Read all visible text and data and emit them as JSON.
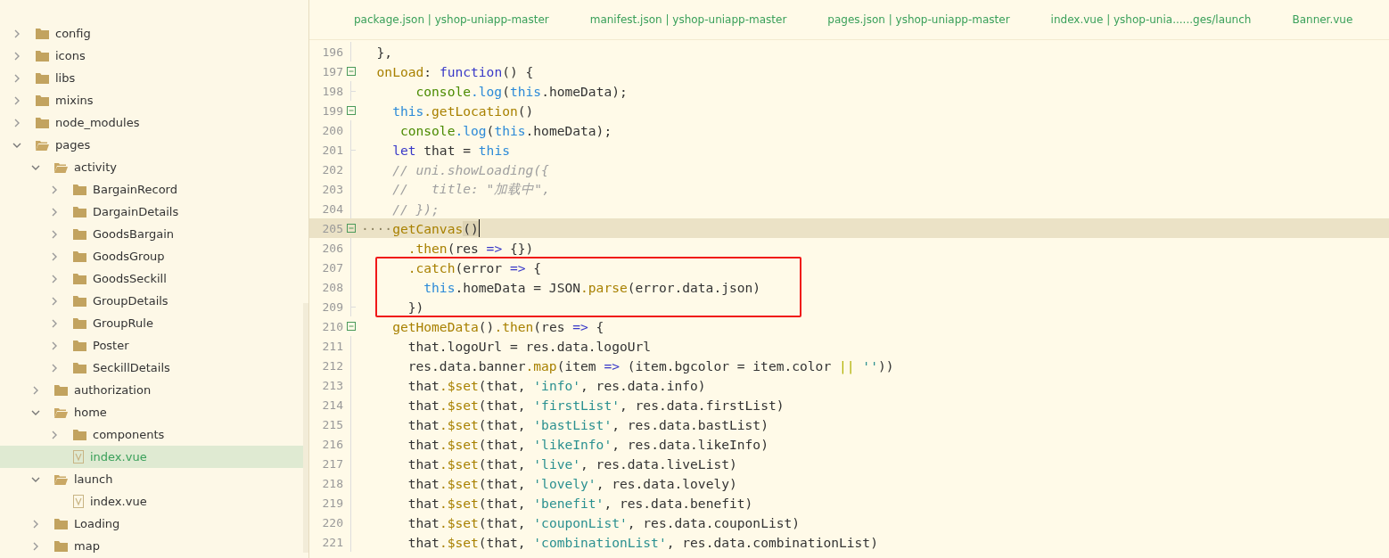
{
  "sidebar": {
    "items": [
      {
        "name": "config",
        "kind": "folder",
        "expanded": false,
        "selected": false
      },
      {
        "name": "icons",
        "kind": "folder",
        "expanded": false,
        "selected": false
      },
      {
        "name": "libs",
        "kind": "folder",
        "expanded": false,
        "selected": false
      },
      {
        "name": "mixins",
        "kind": "folder",
        "expanded": false,
        "selected": false
      },
      {
        "name": "node_modules",
        "kind": "folder",
        "expanded": false,
        "selected": false
      },
      {
        "name": "pages",
        "kind": "folder",
        "expanded": true,
        "selected": false,
        "children": [
          {
            "name": "activity",
            "kind": "folder",
            "expanded": true,
            "selected": false,
            "children": [
              {
                "name": "BargainRecord",
                "kind": "folder",
                "expanded": false,
                "selected": false
              },
              {
                "name": "DargainDetails",
                "kind": "folder",
                "expanded": false,
                "selected": false
              },
              {
                "name": "GoodsBargain",
                "kind": "folder",
                "expanded": false,
                "selected": false
              },
              {
                "name": "GoodsGroup",
                "kind": "folder",
                "expanded": false,
                "selected": false
              },
              {
                "name": "GoodsSeckill",
                "kind": "folder",
                "expanded": false,
                "selected": false
              },
              {
                "name": "GroupDetails",
                "kind": "folder",
                "expanded": false,
                "selected": false
              },
              {
                "name": "GroupRule",
                "kind": "folder",
                "expanded": false,
                "selected": false
              },
              {
                "name": "Poster",
                "kind": "folder",
                "expanded": false,
                "selected": false
              },
              {
                "name": "SeckillDetails",
                "kind": "folder",
                "expanded": false,
                "selected": false
              }
            ]
          },
          {
            "name": "authorization",
            "kind": "folder",
            "expanded": false,
            "selected": false
          },
          {
            "name": "home",
            "kind": "folder",
            "expanded": true,
            "selected": false,
            "children": [
              {
                "name": "components",
                "kind": "folder",
                "expanded": false,
                "selected": false
              },
              {
                "name": "index.vue",
                "kind": "file",
                "selected": true
              }
            ]
          },
          {
            "name": "launch",
            "kind": "folder",
            "expanded": true,
            "selected": false,
            "children": [
              {
                "name": "index.vue",
                "kind": "file",
                "selected": false
              }
            ]
          },
          {
            "name": "Loading",
            "kind": "folder",
            "expanded": false,
            "selected": false
          },
          {
            "name": "map",
            "kind": "folder",
            "expanded": false,
            "selected": false
          }
        ]
      }
    ]
  },
  "tabs": [
    {
      "label": "package.json | yshop-uniapp-master",
      "selected": false
    },
    {
      "label": "manifest.json | yshop-uniapp-master",
      "selected": false
    },
    {
      "label": "pages.json | yshop-uniapp-master",
      "selected": false
    },
    {
      "label": "index.vue | yshop-unia......ges/launch",
      "selected": false
    },
    {
      "label": "Banner.vue",
      "selected": false
    }
  ],
  "editor": {
    "lines": [
      {
        "number": "196",
        "foldable": false,
        "block_end": false,
        "current": false,
        "boxed": false,
        "tokens": [
          {
            "text": "  },",
            "kind": "plain"
          }
        ]
      },
      {
        "number": "197",
        "foldable": true,
        "block_end": false,
        "current": false,
        "boxed": false,
        "tokens": [
          {
            "text": "  onLoad",
            "kind": "prop"
          },
          {
            "text": ": ",
            "kind": "plain"
          },
          {
            "text": "function",
            "kind": "keyword"
          },
          {
            "text": "() {",
            "kind": "plain"
          }
        ]
      },
      {
        "number": "198",
        "foldable": false,
        "block_end": true,
        "current": false,
        "boxed": false,
        "tokens": [
          {
            "text": "       console",
            "kind": "global"
          },
          {
            "text": ".log",
            "kind": "this"
          },
          {
            "text": "(",
            "kind": "plain"
          },
          {
            "text": "this",
            "kind": "this"
          },
          {
            "text": ".homeData);",
            "kind": "plain"
          }
        ]
      },
      {
        "number": "199",
        "foldable": true,
        "block_end": false,
        "current": false,
        "boxed": false,
        "tokens": [
          {
            "text": "    this",
            "kind": "this"
          },
          {
            "text": ".getLocation",
            "kind": "prop"
          },
          {
            "text": "()",
            "kind": "plain"
          }
        ]
      },
      {
        "number": "200",
        "foldable": false,
        "block_end": false,
        "current": false,
        "boxed": false,
        "tokens": [
          {
            "text": "     console",
            "kind": "global"
          },
          {
            "text": ".log",
            "kind": "this"
          },
          {
            "text": "(",
            "kind": "plain"
          },
          {
            "text": "this",
            "kind": "this"
          },
          {
            "text": ".homeData);",
            "kind": "plain"
          }
        ]
      },
      {
        "number": "201",
        "foldable": false,
        "block_end": true,
        "current": false,
        "boxed": false,
        "tokens": [
          {
            "text": "    let",
            "kind": "keyword"
          },
          {
            "text": " that = ",
            "kind": "plain"
          },
          {
            "text": "this",
            "kind": "this"
          }
        ]
      },
      {
        "number": "202",
        "foldable": false,
        "block_end": false,
        "current": false,
        "boxed": false,
        "tokens": [
          {
            "text": "    // uni.showLoading({",
            "kind": "comment"
          }
        ]
      },
      {
        "number": "203",
        "foldable": false,
        "block_end": false,
        "current": false,
        "boxed": false,
        "tokens": [
          {
            "text": "    //   title: \"加载中\",",
            "kind": "comment"
          }
        ]
      },
      {
        "number": "204",
        "foldable": false,
        "block_end": false,
        "current": false,
        "boxed": false,
        "tokens": [
          {
            "text": "    // });",
            "kind": "comment"
          }
        ]
      },
      {
        "number": "205",
        "foldable": true,
        "block_end": false,
        "current": true,
        "boxed": false,
        "tokens": [
          {
            "text": "····",
            "kind": "whitespace"
          },
          {
            "text": "getCanvas",
            "kind": "prop"
          },
          {
            "text": "()",
            "kind": "bracket"
          }
        ]
      },
      {
        "number": "206",
        "foldable": false,
        "block_end": false,
        "current": false,
        "boxed": false,
        "tokens": [
          {
            "text": "      .then",
            "kind": "prop"
          },
          {
            "text": "(res ",
            "kind": "plain"
          },
          {
            "text": "=>",
            "kind": "keyword"
          },
          {
            "text": " {})",
            "kind": "plain"
          }
        ]
      },
      {
        "number": "207",
        "foldable": false,
        "block_end": false,
        "current": false,
        "boxed": true,
        "tokens": [
          {
            "text": "      .catch",
            "kind": "prop"
          },
          {
            "text": "(error ",
            "kind": "plain"
          },
          {
            "text": "=>",
            "kind": "keyword"
          },
          {
            "text": " {",
            "kind": "plain"
          }
        ]
      },
      {
        "number": "208",
        "foldable": false,
        "block_end": false,
        "current": false,
        "boxed": true,
        "tokens": [
          {
            "text": "        this",
            "kind": "this"
          },
          {
            "text": ".homeData = JSON",
            "kind": "plain"
          },
          {
            "text": ".parse",
            "kind": "prop"
          },
          {
            "text": "(error.data.json)",
            "kind": "plain"
          }
        ]
      },
      {
        "number": "209",
        "foldable": false,
        "block_end": true,
        "current": false,
        "boxed": true,
        "tokens": [
          {
            "text": "      })",
            "kind": "plain"
          }
        ]
      },
      {
        "number": "210",
        "foldable": true,
        "block_end": false,
        "current": false,
        "boxed": false,
        "tokens": [
          {
            "text": "    getHomeData",
            "kind": "prop"
          },
          {
            "text": "()",
            "kind": "plain"
          },
          {
            "text": ".then",
            "kind": "prop"
          },
          {
            "text": "(res ",
            "kind": "plain"
          },
          {
            "text": "=>",
            "kind": "keyword"
          },
          {
            "text": " {",
            "kind": "plain"
          }
        ]
      },
      {
        "number": "211",
        "foldable": false,
        "block_end": false,
        "current": false,
        "boxed": false,
        "tokens": [
          {
            "text": "      that.logoUrl = res.data.logoUrl",
            "kind": "plain"
          }
        ]
      },
      {
        "number": "212",
        "foldable": false,
        "block_end": false,
        "current": false,
        "boxed": false,
        "tokens": [
          {
            "text": "      res.data.banner",
            "kind": "plain"
          },
          {
            "text": ".map",
            "kind": "prop"
          },
          {
            "text": "(item ",
            "kind": "plain"
          },
          {
            "text": "=>",
            "kind": "keyword"
          },
          {
            "text": " (item.bgcolor = item.color ",
            "kind": "plain"
          },
          {
            "text": "||",
            "kind": "operator"
          },
          {
            "text": " ''",
            "kind": "string"
          },
          {
            "text": "))",
            "kind": "plain"
          }
        ]
      },
      {
        "number": "213",
        "foldable": false,
        "block_end": false,
        "current": false,
        "boxed": false,
        "tokens": [
          {
            "text": "      that",
            "kind": "plain"
          },
          {
            "text": ".$set",
            "kind": "prop"
          },
          {
            "text": "(that, ",
            "kind": "plain"
          },
          {
            "text": "'info'",
            "kind": "string"
          },
          {
            "text": ", res.data.info)",
            "kind": "plain"
          }
        ]
      },
      {
        "number": "214",
        "foldable": false,
        "block_end": false,
        "current": false,
        "boxed": false,
        "tokens": [
          {
            "text": "      that",
            "kind": "plain"
          },
          {
            "text": ".$set",
            "kind": "prop"
          },
          {
            "text": "(that, ",
            "kind": "plain"
          },
          {
            "text": "'firstList'",
            "kind": "string"
          },
          {
            "text": ", res.data.firstList)",
            "kind": "plain"
          }
        ]
      },
      {
        "number": "215",
        "foldable": false,
        "block_end": false,
        "current": false,
        "boxed": false,
        "tokens": [
          {
            "text": "      that",
            "kind": "plain"
          },
          {
            "text": ".$set",
            "kind": "prop"
          },
          {
            "text": "(that, ",
            "kind": "plain"
          },
          {
            "text": "'bastList'",
            "kind": "string"
          },
          {
            "text": ", res.data.bastList)",
            "kind": "plain"
          }
        ]
      },
      {
        "number": "216",
        "foldable": false,
        "block_end": false,
        "current": false,
        "boxed": false,
        "tokens": [
          {
            "text": "      that",
            "kind": "plain"
          },
          {
            "text": ".$set",
            "kind": "prop"
          },
          {
            "text": "(that, ",
            "kind": "plain"
          },
          {
            "text": "'likeInfo'",
            "kind": "string"
          },
          {
            "text": ", res.data.likeInfo)",
            "kind": "plain"
          }
        ]
      },
      {
        "number": "217",
        "foldable": false,
        "block_end": false,
        "current": false,
        "boxed": false,
        "tokens": [
          {
            "text": "      that",
            "kind": "plain"
          },
          {
            "text": ".$set",
            "kind": "prop"
          },
          {
            "text": "(that, ",
            "kind": "plain"
          },
          {
            "text": "'live'",
            "kind": "string"
          },
          {
            "text": ", res.data.liveList)",
            "kind": "plain"
          }
        ]
      },
      {
        "number": "218",
        "foldable": false,
        "block_end": false,
        "current": false,
        "boxed": false,
        "tokens": [
          {
            "text": "      that",
            "kind": "plain"
          },
          {
            "text": ".$set",
            "kind": "prop"
          },
          {
            "text": "(that, ",
            "kind": "plain"
          },
          {
            "text": "'lovely'",
            "kind": "string"
          },
          {
            "text": ", res.data.lovely)",
            "kind": "plain"
          }
        ]
      },
      {
        "number": "219",
        "foldable": false,
        "block_end": false,
        "current": false,
        "boxed": false,
        "tokens": [
          {
            "text": "      that",
            "kind": "plain"
          },
          {
            "text": ".$set",
            "kind": "prop"
          },
          {
            "text": "(that, ",
            "kind": "plain"
          },
          {
            "text": "'benefit'",
            "kind": "string"
          },
          {
            "text": ", res.data.benefit)",
            "kind": "plain"
          }
        ]
      },
      {
        "number": "220",
        "foldable": false,
        "block_end": false,
        "current": false,
        "boxed": false,
        "tokens": [
          {
            "text": "      that",
            "kind": "plain"
          },
          {
            "text": ".$set",
            "kind": "prop"
          },
          {
            "text": "(that, ",
            "kind": "plain"
          },
          {
            "text": "'couponList'",
            "kind": "string"
          },
          {
            "text": ", res.data.couponList)",
            "kind": "plain"
          }
        ]
      },
      {
        "number": "221",
        "foldable": false,
        "block_end": false,
        "current": false,
        "boxed": false,
        "tokens": [
          {
            "text": "      that",
            "kind": "plain"
          },
          {
            "text": ".$set",
            "kind": "prop"
          },
          {
            "text": "(that, ",
            "kind": "plain"
          },
          {
            "text": "'combinationList'",
            "kind": "string"
          },
          {
            "text": ", res.data.combinationList)",
            "kind": "plain"
          }
        ]
      }
    ]
  }
}
